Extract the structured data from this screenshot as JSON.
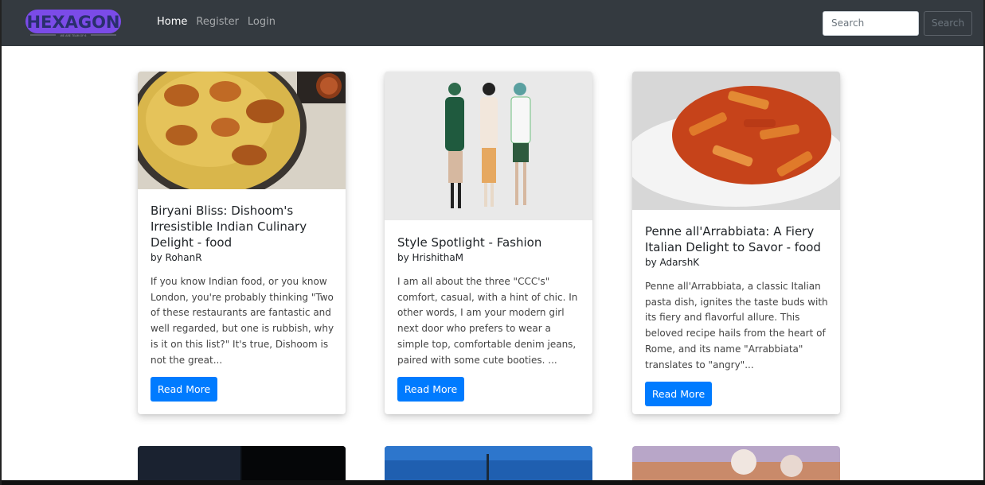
{
  "brand": {
    "logo_text": "HEXAGON",
    "logo_tagline": "WE ARE TEAM OF 6"
  },
  "nav": {
    "items": [
      {
        "label": "Home"
      },
      {
        "label": "Register"
      },
      {
        "label": "Login"
      }
    ]
  },
  "search": {
    "placeholder": "Search",
    "button_label": "Search"
  },
  "posts": [
    {
      "title": "Biryani Bliss: Dishoom's Irresistible Indian Culinary Delight - food",
      "author": "by RohanR",
      "excerpt": "If you know Indian food, or you know London, you're probably thinking \"Two of these restaurants are fantastic and well regarded, but one is rubbish, why is it on this list?\" It's true, Dishoom is not the great...",
      "button_label": "Read More"
    },
    {
      "title": "Style Spotlight - Fashion",
      "author": "by HrishithaM",
      "excerpt": "I am all about the three \"CCC's\" comfort, casual, with a hint of chic. In other words, I am your modern girl next door who prefers to wear a simple top, comfortable denim jeans, paired with some cute booties. ...",
      "button_label": "Read More"
    },
    {
      "title": "Penne all'Arrabbiata: A Fiery Italian Delight to Savor - food",
      "author": "by AdarshK",
      "excerpt": "Penne all'Arrabbiata, a classic Italian pasta dish, ignites the taste buds with its fiery and flavorful allure. This beloved recipe hails from the heart of Rome, and its name \"Arrabbiata\" translates to \"angry\"...",
      "button_label": "Read More"
    }
  ],
  "colors": {
    "navbar": "#343a40",
    "accent": "#007bff",
    "logo": "#7b4be8"
  }
}
